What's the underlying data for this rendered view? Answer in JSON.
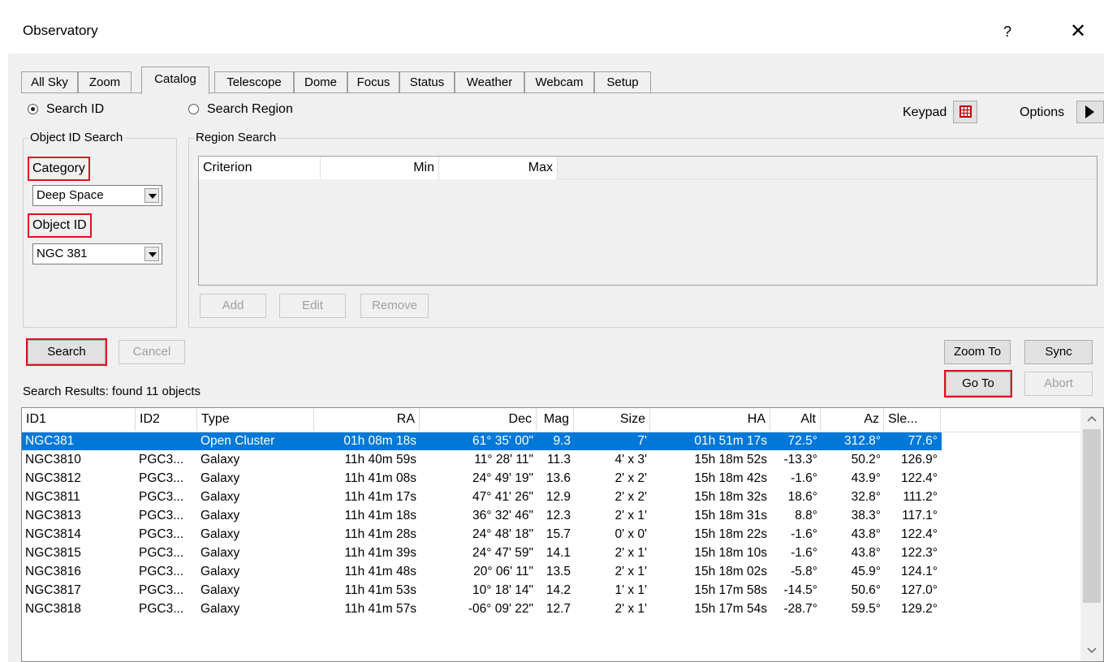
{
  "window": {
    "title": "Observatory",
    "help": "?",
    "close": "✕"
  },
  "tabs": [
    "All Sky",
    "Zoom",
    "Catalog",
    "Telescope",
    "Dome",
    "Focus",
    "Status",
    "Weather",
    "Webcam",
    "Setup"
  ],
  "mode": {
    "search_id": "Search ID",
    "search_region": "Search Region",
    "keypad": "Keypad",
    "options": "Options"
  },
  "object_search": {
    "legend": "Object ID Search",
    "category_label": "Category",
    "category_value": "Deep Space",
    "object_label": "Object ID",
    "object_value": "NGC 381"
  },
  "region_search": {
    "legend": "Region Search",
    "columns": [
      "Criterion",
      "Min",
      "Max"
    ],
    "add": "Add",
    "edit": "Edit",
    "remove": "Remove"
  },
  "actions": {
    "search": "Search",
    "cancel": "Cancel",
    "zoom_to": "Zoom To",
    "sync": "Sync",
    "go_to": "Go To",
    "abort": "Abort"
  },
  "results": {
    "summary": "Search Results: found 11 objects",
    "columns": [
      "ID1",
      "ID2",
      "Type",
      "RA",
      "Dec",
      "Mag",
      "Size",
      "HA",
      "Alt",
      "Az",
      "Sle..."
    ],
    "rows": [
      [
        "NGC381",
        "",
        "Open Cluster",
        "01h 08m 18s",
        "61° 35' 00\"",
        "9.3",
        "7'",
        "01h 51m 17s",
        "72.5°",
        "312.8°",
        "77.6°"
      ],
      [
        "NGC3810",
        "PGC3...",
        "Galaxy",
        "11h 40m 59s",
        "11° 28' 11\"",
        "11.3",
        "4' x 3'",
        "15h 18m 52s",
        "-13.3°",
        "50.2°",
        "126.9°"
      ],
      [
        "NGC3812",
        "PGC3...",
        "Galaxy",
        "11h 41m 08s",
        "24° 49' 19\"",
        "13.6",
        "2' x 2'",
        "15h 18m 42s",
        "-1.6°",
        "43.9°",
        "122.4°"
      ],
      [
        "NGC3811",
        "PGC3...",
        "Galaxy",
        "11h 41m 17s",
        "47° 41' 26\"",
        "12.9",
        "2' x 2'",
        "15h 18m 32s",
        "18.6°",
        "32.8°",
        "111.2°"
      ],
      [
        "NGC3813",
        "PGC3...",
        "Galaxy",
        "11h 41m 18s",
        "36° 32' 46\"",
        "12.3",
        "2' x 1'",
        "15h 18m 31s",
        "8.8°",
        "38.3°",
        "117.1°"
      ],
      [
        "NGC3814",
        "PGC3...",
        "Galaxy",
        "11h 41m 28s",
        "24° 48' 18\"",
        "15.7",
        "0' x 0'",
        "15h 18m 22s",
        "-1.6°",
        "43.8°",
        "122.4°"
      ],
      [
        "NGC3815",
        "PGC3...",
        "Galaxy",
        "11h 41m 39s",
        "24° 47' 59\"",
        "14.1",
        "2' x 1'",
        "15h 18m 10s",
        "-1.6°",
        "43.8°",
        "122.3°"
      ],
      [
        "NGC3816",
        "PGC3...",
        "Galaxy",
        "11h 41m 48s",
        "20° 06' 11\"",
        "13.5",
        "2' x 1'",
        "15h 18m 02s",
        "-5.8°",
        "45.9°",
        "124.1°"
      ],
      [
        "NGC3817",
        "PGC3...",
        "Galaxy",
        "11h 41m 53s",
        "10° 18' 14\"",
        "14.2",
        "1' x 1'",
        "15h 17m 58s",
        "-14.5°",
        "50.6°",
        "127.0°"
      ],
      [
        "NGC3818",
        "PGC3...",
        "Galaxy",
        "11h 41m 57s",
        "-06° 09' 22\"",
        "12.7",
        "2' x 1'",
        "15h 17m 54s",
        "-28.7°",
        "59.5°",
        "129.2°"
      ]
    ]
  },
  "colors": {
    "selection": "#0078d7",
    "highlight": "#e01020"
  }
}
